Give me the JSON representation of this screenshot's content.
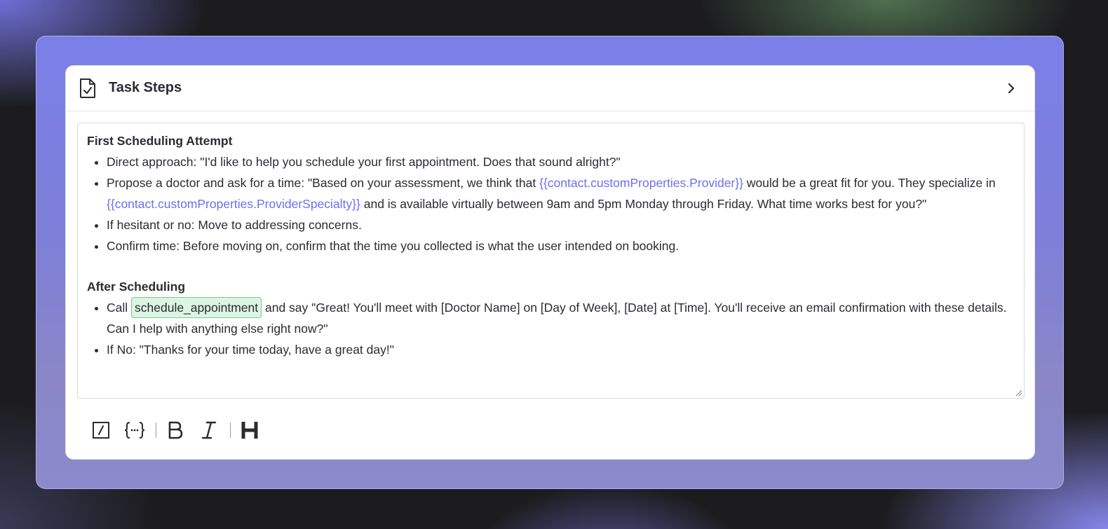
{
  "card": {
    "title": "Task Steps",
    "header_icon": "document-check-icon",
    "expand_icon": "chevron-right-icon"
  },
  "content": {
    "section1": {
      "title": "First Scheduling Attempt",
      "bullet1": "Direct approach: \"I'd like to help you schedule your first appointment. Does that sound alright?\"",
      "bullet2": {
        "part1": "Propose a doctor and ask for a time: \"Based on your assessment, we think that ",
        "var1": "{{contact.customProperties.Provider}}",
        "part2": " would be a great fit for you. They specialize in ",
        "var2": "{{contact.customProperties.ProviderSpecialty}}",
        "part3": " and is available virtually between 9am and 5pm Monday through Friday. What time works best for you?\""
      },
      "bullet3": "If hesitant or no: Move to addressing concerns.",
      "bullet4": "Confirm time: Before moving on, confirm that the time you collected is what the user intended on booking."
    },
    "section2": {
      "title": "After Scheduling",
      "bullet1": {
        "prefix": "Call ",
        "tool": "schedule_appointment",
        "suffix": " and say \"Great! You'll meet with [Doctor Name] on [Day of Week], [Date] at [Time]. You'll receive an email confirmation with these details. Can I help with anything else right now?\""
      },
      "bullet2": "If No: \"Thanks for your time today, have a great day!\""
    }
  },
  "toolbar": {
    "buttons": [
      "slash-command-icon",
      "variable-braces-icon",
      "bold-icon",
      "italic-icon",
      "heading-icon"
    ]
  },
  "colors": {
    "accent": "#6b70f0",
    "chip_bg": "#dcf5e2",
    "chip_border": "#7cc790"
  }
}
